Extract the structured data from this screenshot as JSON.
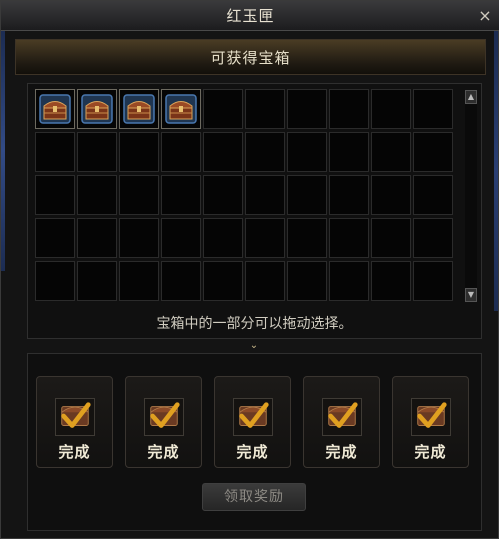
{
  "window": {
    "title": "红玉匣",
    "close_glyph": "×"
  },
  "header": {
    "title": "可获得宝箱"
  },
  "chest_grid": {
    "columns": 10,
    "rows": 5,
    "filled_slots": [
      0,
      1,
      2,
      3
    ],
    "item_icon": "treasure-chest-icon"
  },
  "scrollbar": {
    "up_glyph": "▲",
    "down_glyph": "▼"
  },
  "hint": "宝箱中的一部分可以拖动选择。",
  "expand_glyph": "⌄",
  "rewards": [
    {
      "label": "完成",
      "icon": "checkmark-icon"
    },
    {
      "label": "完成",
      "icon": "checkmark-icon"
    },
    {
      "label": "完成",
      "icon": "checkmark-icon"
    },
    {
      "label": "完成",
      "icon": "checkmark-icon"
    },
    {
      "label": "完成",
      "icon": "checkmark-icon"
    }
  ],
  "claim_button": {
    "label": "领取奖励",
    "enabled": false
  },
  "colors": {
    "accent_gold": "#e0a020",
    "chest_brown": "#9a4a24",
    "frame_blue": "#4a78b0"
  }
}
